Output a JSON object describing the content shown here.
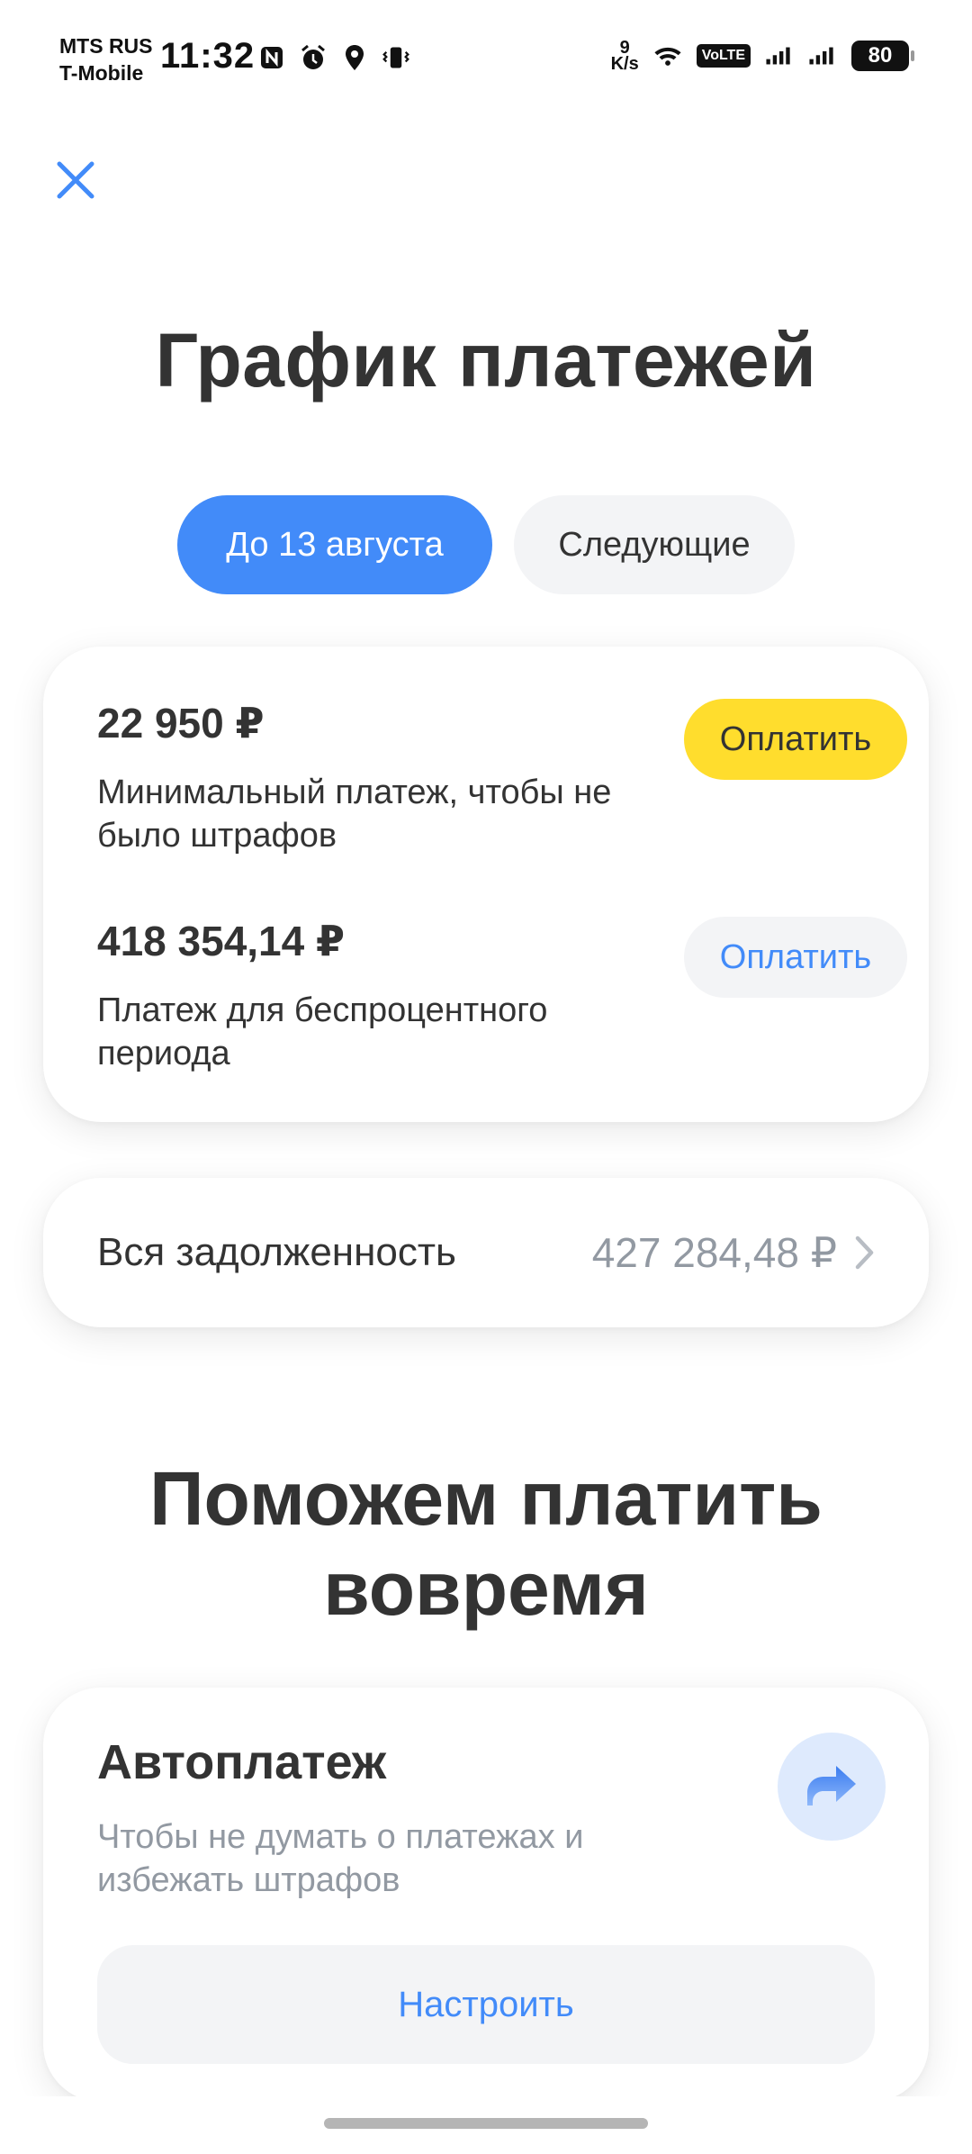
{
  "status_bar": {
    "carrier_1": "MTS RUS",
    "carrier_2": "T-Mobile",
    "time": "11:32",
    "net_speed_value": "9",
    "net_speed_unit": "K/s",
    "volte_label": "VoLTE",
    "battery_level": "80",
    "icons_left": [
      "nfc-icon",
      "alarm-icon",
      "location-icon",
      "vibrate-icon"
    ],
    "icons_right": [
      "wifi-icon",
      "volte-icon",
      "signal-icon",
      "signal-icon",
      "battery-icon"
    ]
  },
  "header": {
    "close_icon": "close-icon",
    "title": "График платежей"
  },
  "tabs": [
    {
      "label": "До 13 августа",
      "active": true
    },
    {
      "label": "Следующие",
      "active": false
    }
  ],
  "payments": [
    {
      "amount": "22 950 ₽",
      "description": "Минимальный платеж, чтобы не было штрафов",
      "button": "Оплатить",
      "style": "primary"
    },
    {
      "amount": "418 354,14 ₽",
      "description": "Платеж для беспроцентного периода",
      "button": "Оплатить",
      "style": "secondary"
    }
  ],
  "debt": {
    "label": "Вся задолженность",
    "value": "427 284,48 ₽",
    "icon": "chevron-right-icon"
  },
  "help_section": {
    "title": "Поможем платить вовремя"
  },
  "autopay": {
    "title": "Автоплатеж",
    "description": "Чтобы не думать о платежах и избежать штрафов",
    "icon": "forward-arrow-icon",
    "button": "Настроить"
  },
  "colors": {
    "accent_blue": "#428bf9",
    "pay_yellow": "#ffdd2d",
    "text_primary": "#333333",
    "text_secondary": "#9299a2",
    "chip_gray": "#f3f4f6"
  }
}
